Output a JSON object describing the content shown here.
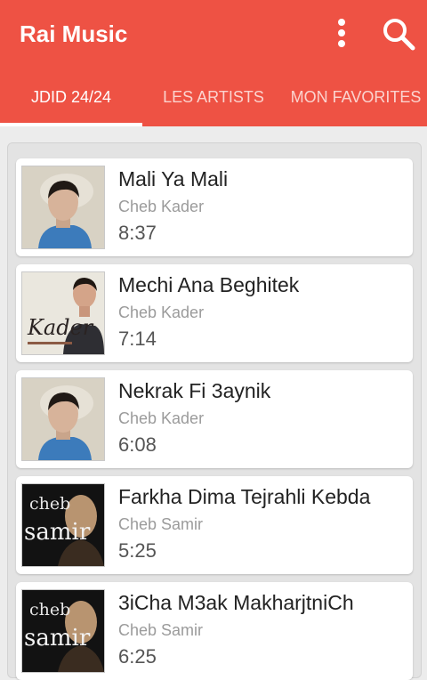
{
  "app": {
    "title": "Rai Music",
    "accent": "#ee5244"
  },
  "toolbar": {
    "menu_icon": "more-vert-icon",
    "search_icon": "search-icon"
  },
  "tabs": [
    {
      "label": "JDID 24/24",
      "selected": true
    },
    {
      "label": "LES ARTISTS",
      "selected": false
    },
    {
      "label": "MON FAVORITES",
      "selected": false
    }
  ],
  "songs": [
    {
      "title": "Mali Ya Mali",
      "artist": "Cheb Kader",
      "duration": "8:37",
      "cover": "kader-portrait"
    },
    {
      "title": "Mechi Ana Beghitek",
      "artist": "Cheb Kader",
      "duration": "7:14",
      "cover": "kader-album",
      "cover_text": "Kader"
    },
    {
      "title": "Nekrak Fi 3aynik",
      "artist": "Cheb Kader",
      "duration": "6:08",
      "cover": "kader-portrait"
    },
    {
      "title": "Farkha Dima Tejrahli Kebda",
      "artist": "Cheb Samir",
      "duration": "5:25",
      "cover": "samir-album",
      "cover_text_1": "cheb",
      "cover_text_2": "samir"
    },
    {
      "title": "3iCha M3ak MakharjtniCh",
      "artist": "Cheb Samir",
      "duration": "6:25",
      "cover": "samir-album",
      "cover_text_1": "cheb",
      "cover_text_2": "samir"
    }
  ]
}
